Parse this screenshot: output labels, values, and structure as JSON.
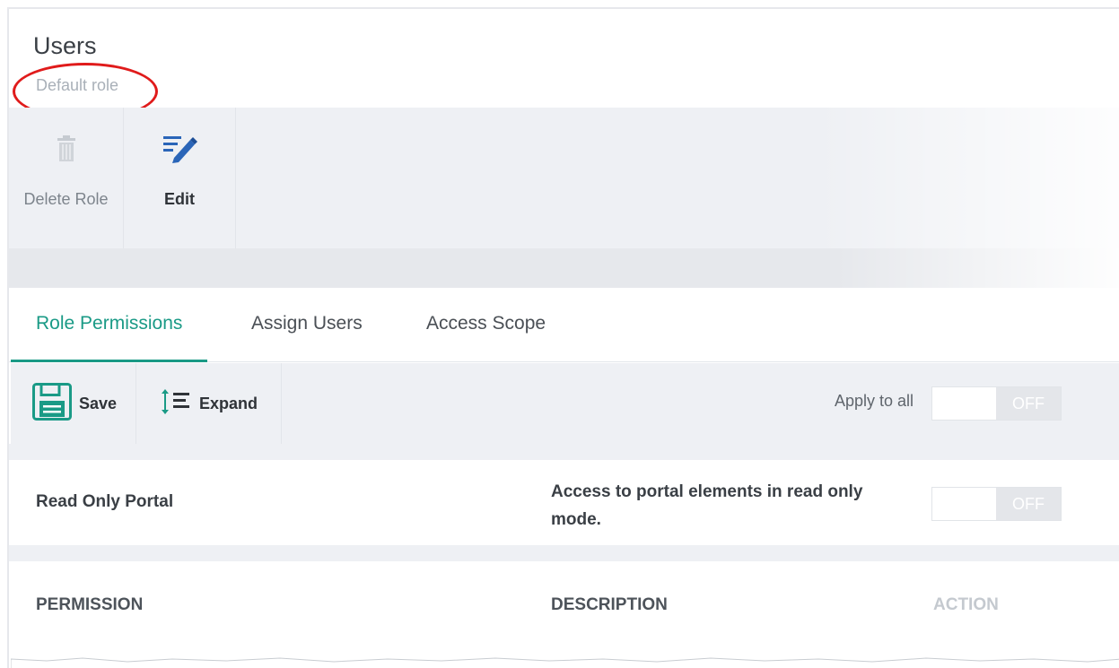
{
  "page": {
    "title": "Users",
    "subtitle": "Default role"
  },
  "toolbar": {
    "delete_label": "Delete Role",
    "edit_label": "Edit"
  },
  "tabs": [
    {
      "label": "Role Permissions",
      "active": true
    },
    {
      "label": "Assign Users",
      "active": false
    },
    {
      "label": "Access Scope",
      "active": false
    }
  ],
  "actions": {
    "save_label": "Save",
    "expand_label": "Expand",
    "apply_all_label": "Apply to all",
    "apply_all_state": "OFF"
  },
  "permission_row": {
    "name": "Read Only Portal",
    "description": "Access to portal elements in read only mode.",
    "state": "OFF"
  },
  "table_headers": {
    "permission": "PERMISSION",
    "description": "DESCRIPTION",
    "action": "ACTION"
  },
  "colors": {
    "accent": "#1a9a86",
    "edit_icon": "#2a65b8",
    "highlight_circle": "#e01b1b"
  },
  "icons": {
    "delete": "trash-icon",
    "edit": "pencil-lines-icon",
    "save": "floppy-disk-icon",
    "expand": "expand-list-icon"
  }
}
